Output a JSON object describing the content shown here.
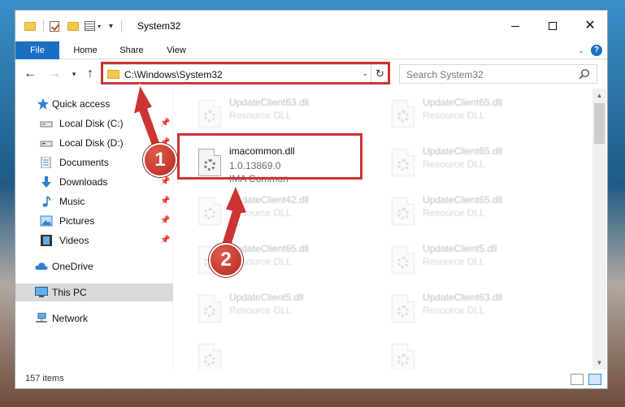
{
  "window": {
    "title": "System32",
    "quick_access_toolbar": [
      "folder-icon",
      "properties-check-icon",
      "new-folder-icon",
      "properties-icon",
      "customize-dropdown-icon"
    ],
    "controls": {
      "minimize": "minimize-icon",
      "maximize": "maximize-icon",
      "close": "close-icon"
    }
  },
  "ribbon": {
    "tabs": [
      {
        "label": "File"
      },
      {
        "label": "Home"
      },
      {
        "label": "Share"
      },
      {
        "label": "View"
      }
    ],
    "help": "?"
  },
  "nav": {
    "address": "C:\\Windows\\System32",
    "search_placeholder": "Search System32"
  },
  "sidebar": {
    "items": [
      {
        "label": "Quick access",
        "icon": "star-icon",
        "pinned": false
      },
      {
        "label": "Local Disk (C:)",
        "icon": "drive-icon",
        "pinned": true
      },
      {
        "label": "Local Disk (D:)",
        "icon": "drive-icon",
        "pinned": true
      },
      {
        "label": "Documents",
        "icon": "documents-icon",
        "pinned": true
      },
      {
        "label": "Downloads",
        "icon": "download-arrow-icon",
        "pinned": true
      },
      {
        "label": "Music",
        "icon": "music-note-icon",
        "pinned": true
      },
      {
        "label": "Pictures",
        "icon": "pictures-icon",
        "pinned": true
      },
      {
        "label": "Videos",
        "icon": "film-icon",
        "pinned": true
      },
      {
        "label": "OneDrive",
        "icon": "cloud-icon",
        "pinned": false
      },
      {
        "label": "This PC",
        "icon": "monitor-icon",
        "pinned": false,
        "selected": true
      },
      {
        "label": "Network",
        "icon": "network-icon",
        "pinned": false
      }
    ]
  },
  "files": {
    "highlighted": {
      "name": "imacommon.dll",
      "version": "1.0.13869.0",
      "description": "IMA Common"
    },
    "faded": [
      {
        "name": "UpdateClient63.dll",
        "type": "Resource DLL"
      },
      {
        "name": "UpdateClient65.dll",
        "type": "Resource DLL"
      },
      {
        "name": "UpdateClient65.dll",
        "type": "Resource DLL"
      },
      {
        "name": "UpdateClient42.dll",
        "type": "Resource DLL"
      },
      {
        "name": "UpdateClient65.dll",
        "type": "Resource DLL"
      },
      {
        "name": "UpdateClient65.dll",
        "type": "Resource DLL"
      },
      {
        "name": "UpdateClient5.dll",
        "type": "Resource DLL"
      },
      {
        "name": "UpdateClient5.dll",
        "type": "Resource DLL"
      },
      {
        "name": "UpdateClient63.dll",
        "type": "Resource DLL"
      }
    ]
  },
  "status": {
    "item_count": "157 items"
  },
  "callouts": {
    "one": "1",
    "two": "2",
    "color": "#cc3333"
  }
}
